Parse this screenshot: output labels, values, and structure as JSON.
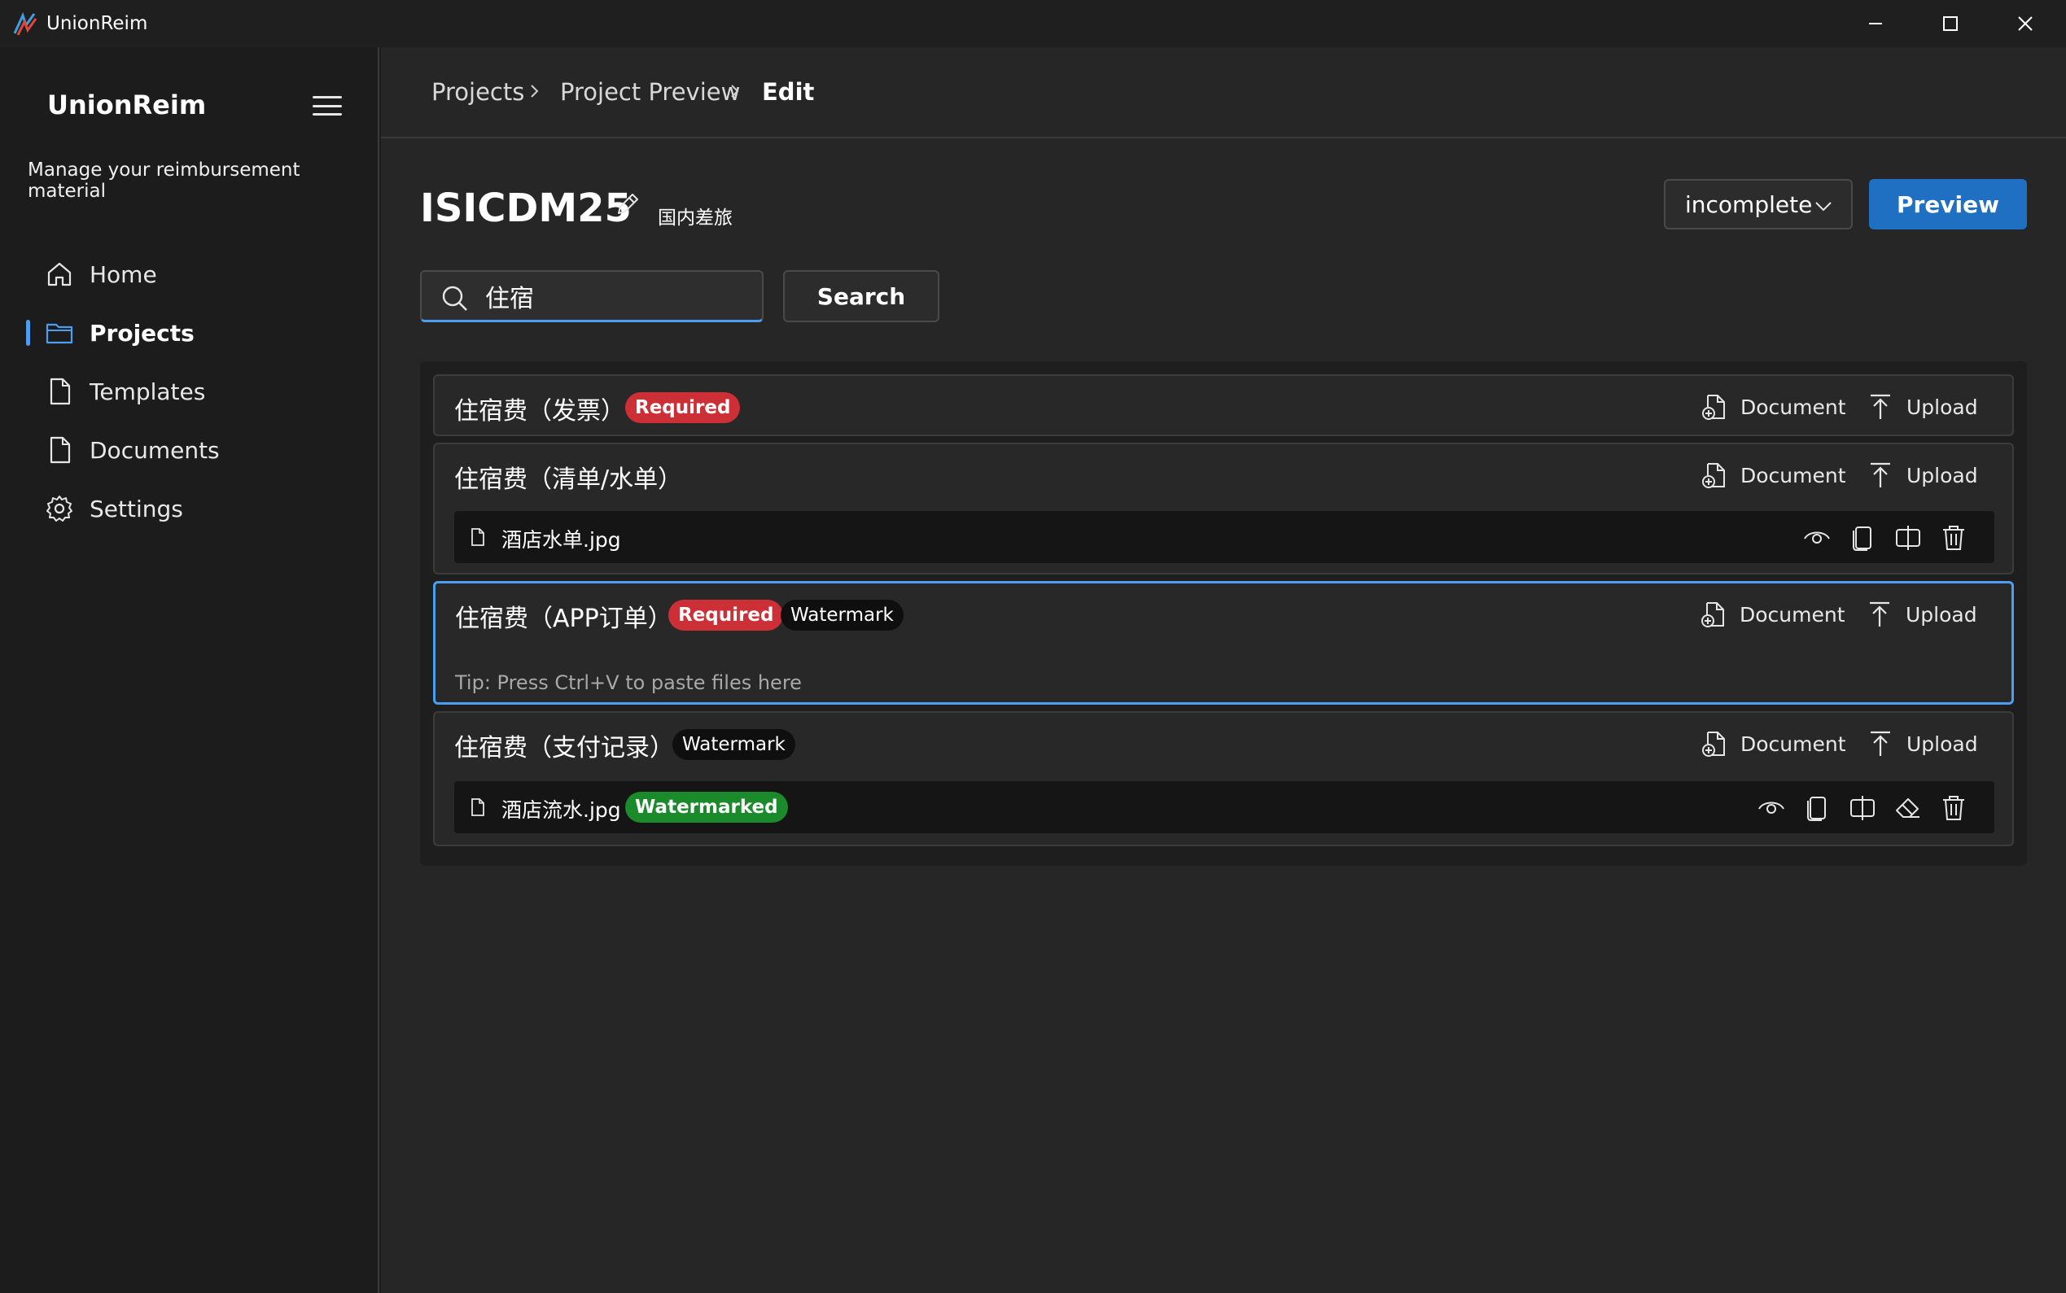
{
  "window": {
    "title": "UnionReim"
  },
  "sidebar": {
    "brand": "UnionReim",
    "tagline": "Manage your reimbursement material",
    "items": [
      {
        "label": "Home",
        "icon": "home-icon"
      },
      {
        "label": "Projects",
        "icon": "folder-icon",
        "active": true
      },
      {
        "label": "Templates",
        "icon": "template-icon"
      },
      {
        "label": "Documents",
        "icon": "document-icon"
      },
      {
        "label": "Settings",
        "icon": "gear-icon"
      }
    ]
  },
  "breadcrumb": {
    "items": [
      "Projects",
      "Project Preview",
      "Edit"
    ]
  },
  "project": {
    "name": "ISICDM25",
    "category": "国内差旅",
    "status": "incomplete",
    "preview_label": "Preview"
  },
  "search": {
    "value": "住宿",
    "button_label": "Search"
  },
  "actions": {
    "document_label": "Document",
    "upload_label": "Upload"
  },
  "items": [
    {
      "title": "住宿费（发票）",
      "badges": [
        "Required"
      ],
      "files": []
    },
    {
      "title": "住宿费（清单/水单）",
      "badges": [],
      "files": [
        {
          "name": "酒店水单.jpg",
          "badges": []
        }
      ]
    },
    {
      "title": "住宿费（APP订单）",
      "badges": [
        "Required",
        "Watermark"
      ],
      "tip": "Tip: Press Ctrl+V to paste files here",
      "selected": true,
      "files": []
    },
    {
      "title": "住宿费（支付记录）",
      "badges": [
        "Watermark"
      ],
      "files": [
        {
          "name": "酒店流水.jpg",
          "badges": [
            "Watermarked"
          ]
        }
      ]
    }
  ],
  "colors": {
    "accent": "#4c9ff0",
    "primary_button": "#1f6fc2",
    "required_badge": "#cc2f36",
    "watermarked_badge": "#1b8a2a"
  }
}
